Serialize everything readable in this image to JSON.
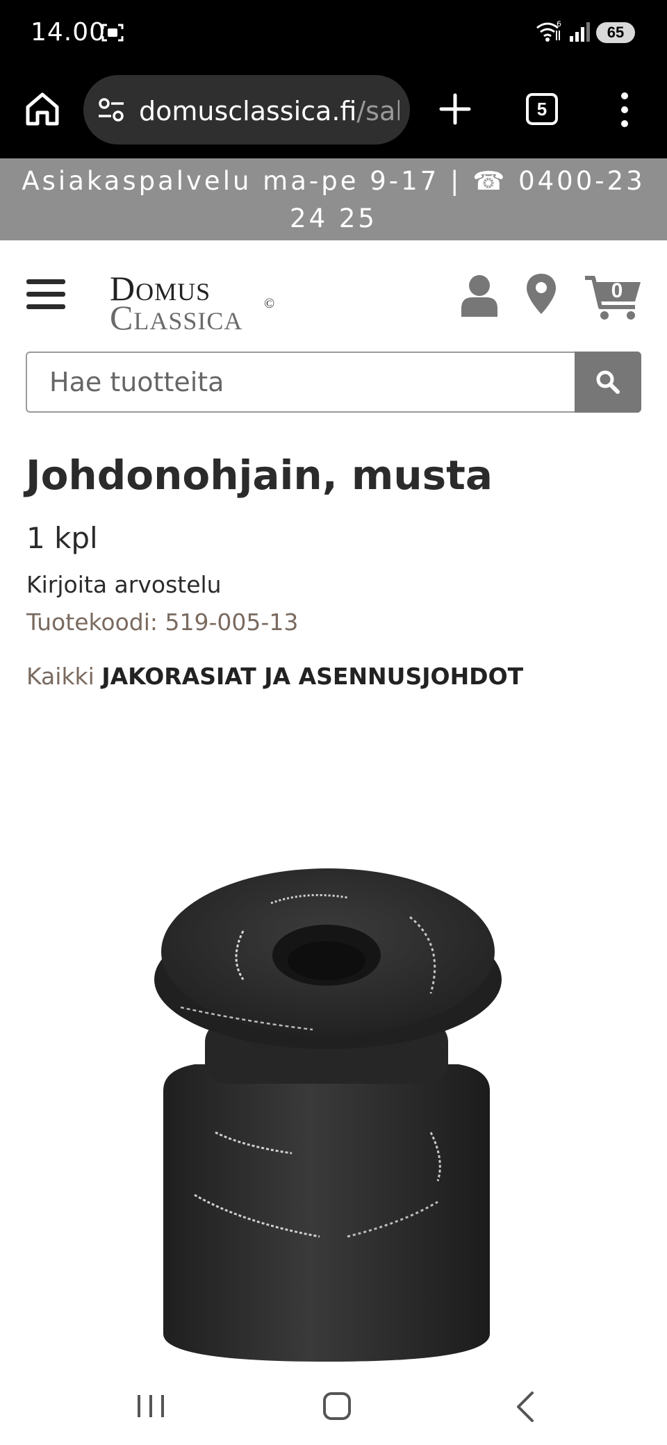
{
  "status_bar": {
    "time": "14.00",
    "battery": "65",
    "icons": [
      "screenshot-icon",
      "wifi-icon",
      "signal-icon",
      "battery-icon"
    ]
  },
  "browser": {
    "url_domain": "domusclassica.fi",
    "url_path": "/sah",
    "tab_count": "5",
    "icons": [
      "home-icon",
      "site-settings-icon",
      "plus-icon",
      "more-vert-icon"
    ]
  },
  "info_strip": {
    "text": "Asiakaspalvelu ma-pe 9-17 | ☎ 0400-23 24 25"
  },
  "header": {
    "logo_line1_first": "D",
    "logo_line1_rest": "OMUS",
    "logo_line2_first": "C",
    "logo_line2_rest": "LASSICA",
    "logo_mark": "©",
    "cart_count": "0",
    "icons": [
      "menu-icon",
      "account-icon",
      "location-icon",
      "cart-icon"
    ]
  },
  "search": {
    "placeholder": "Hae tuotteita",
    "value": ""
  },
  "product": {
    "title": "Johdonohjain, musta",
    "unit": "1 kpl",
    "review_link": "Kirjoita arvostelu",
    "code": "Tuotekoodi: 519-005-13",
    "category_prefix": "Kaikki",
    "category_link": "JAKORASIAT JA ASENNUSJOHDOT"
  },
  "colors": {
    "info_strip_bg": "#8f8f8f",
    "search_button_bg": "#777777",
    "icon_gray": "#777777",
    "product_black": "#2a2a2a"
  }
}
